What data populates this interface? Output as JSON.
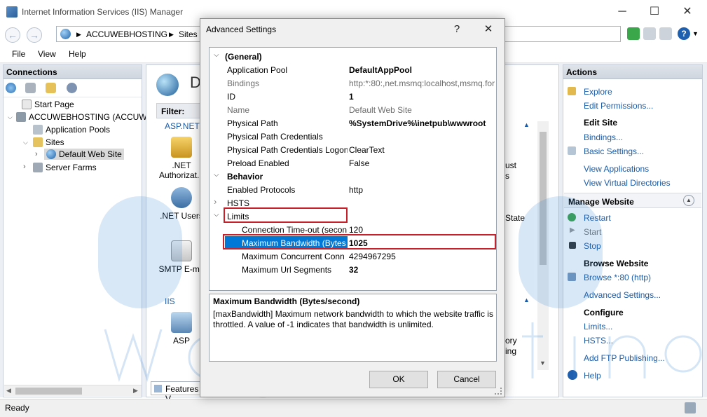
{
  "window": {
    "title": "Internet Information Services (IIS) Manager",
    "minimize": "─",
    "maximize": "☐",
    "close": "✕"
  },
  "address": {
    "segments": [
      "ACCUWEBHOSTING",
      "Sites"
    ],
    "separator": "▶"
  },
  "menu": [
    "File",
    "View",
    "Help"
  ],
  "connections": {
    "title": "Connections",
    "tree": [
      {
        "label": "Start Page",
        "icon": "start-page-icon"
      },
      {
        "label": "ACCUWEBHOSTING (ACCUW",
        "icon": "server-icon"
      },
      {
        "label": "Application Pools",
        "icon": "app-pools-icon"
      },
      {
        "label": "Sites",
        "icon": "sites-folder-icon"
      },
      {
        "label": "Default Web Site",
        "icon": "globe-icon"
      },
      {
        "label": "Server Farms",
        "icon": "server-farms-icon"
      }
    ]
  },
  "center": {
    "heading_partial": "D",
    "filter_label": "Filter:",
    "group_aspnet": "ASP.NET",
    "group_iis": "IIS",
    "features": [
      {
        "label": ".NET Authorizat...",
        "icon": "lock-icon"
      },
      {
        "label": ".NET Users",
        "icon": "users-icon"
      },
      {
        "label": "SMTP E-ma",
        "icon": "mail-icon"
      },
      {
        "label": "ASP",
        "icon": "asp-icon"
      }
    ],
    "right_partial": [
      "ust",
      "s",
      "State",
      "ory",
      "ing"
    ],
    "features_view_tab": "Features V"
  },
  "actions": {
    "title": "Actions",
    "items": [
      {
        "text": "Explore",
        "kind": "link"
      },
      {
        "text": "Edit Permissions...",
        "kind": "link"
      },
      {
        "text": "Edit Site",
        "kind": "head"
      },
      {
        "text": "Bindings...",
        "kind": "link"
      },
      {
        "text": "Basic Settings...",
        "kind": "link"
      },
      {
        "text": "View Applications",
        "kind": "link"
      },
      {
        "text": "View Virtual Directories",
        "kind": "link"
      },
      {
        "text": "Manage Website",
        "kind": "section"
      },
      {
        "text": "Restart",
        "kind": "link"
      },
      {
        "text": "Start",
        "kind": "disabled"
      },
      {
        "text": "Stop",
        "kind": "link"
      },
      {
        "text": "Browse Website",
        "kind": "head"
      },
      {
        "text": "Browse *:80 (http)",
        "kind": "link"
      },
      {
        "text": "Advanced Settings...",
        "kind": "link"
      },
      {
        "text": "Configure",
        "kind": "head"
      },
      {
        "text": "Limits...",
        "kind": "link"
      },
      {
        "text": "HSTS...",
        "kind": "link"
      },
      {
        "text": "Add FTP Publishing...",
        "kind": "link"
      },
      {
        "text": "Help",
        "kind": "link"
      }
    ]
  },
  "status": {
    "text": "Ready"
  },
  "dialog": {
    "title": "Advanced Settings",
    "help": "?",
    "close": "✕",
    "rows": [
      {
        "label": "(General)",
        "value": "",
        "type": "cat",
        "chevron": "⌵"
      },
      {
        "label": "Application Pool",
        "value": "DefaultAppPool",
        "type": "prop",
        "bold": true
      },
      {
        "label": "Bindings",
        "value": "http:*:80:,net.msmq:localhost,msmq.for",
        "type": "prop",
        "gray": true
      },
      {
        "label": "ID",
        "value": "1",
        "type": "prop",
        "bold": true
      },
      {
        "label": "Name",
        "value": "Default Web Site",
        "type": "prop",
        "gray": true
      },
      {
        "label": "Physical Path",
        "value": "%SystemDrive%\\inetpub\\wwwroot",
        "type": "prop",
        "bold": true
      },
      {
        "label": "Physical Path Credentials",
        "value": "",
        "type": "prop"
      },
      {
        "label": "Physical Path Credentials Logon",
        "value": "ClearText",
        "type": "prop"
      },
      {
        "label": "Preload Enabled",
        "value": "False",
        "type": "prop"
      },
      {
        "label": "Behavior",
        "value": "",
        "type": "cat",
        "chevron": "⌵"
      },
      {
        "label": "Enabled Protocols",
        "value": "http",
        "type": "prop"
      },
      {
        "label": "HSTS",
        "value": "",
        "type": "subcat",
        "chevron": "›"
      },
      {
        "label": "Limits",
        "value": "",
        "type": "subcat",
        "chevron": "⌵"
      },
      {
        "label": "Connection Time-out (secon",
        "value": "120",
        "type": "child"
      },
      {
        "label": "Maximum Bandwidth (Bytes",
        "value": "1025",
        "type": "child",
        "selected": true,
        "bold": true
      },
      {
        "label": "Maximum Concurrent Conn",
        "value": "4294967295",
        "type": "child"
      },
      {
        "label": "Maximum Url Segments",
        "value": "32",
        "type": "child",
        "bold": true
      }
    ],
    "description": {
      "title": "Maximum Bandwidth (Bytes/second)",
      "text": "[maxBandwidth] Maximum network bandwidth to which the website traffic is throttled.  A value of -1 indicates that bandwidth is unlimited."
    },
    "ok": "OK",
    "cancel": "Cancel"
  },
  "colors": {
    "selection": "#0078d7",
    "highlight_box": "#c8202a",
    "link": "#1b5ca8",
    "watermark": "#2f7fd3"
  }
}
